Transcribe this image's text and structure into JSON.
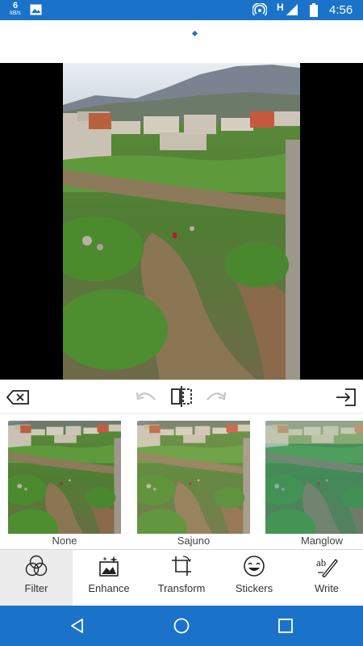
{
  "status_bar": {
    "speed_value": "6",
    "speed_unit": "kB/s",
    "network_type": "H",
    "time": "4:56",
    "icons": [
      "image-icon",
      "hotspot-icon",
      "signal-icon",
      "battery-icon"
    ]
  },
  "filters": [
    {
      "label": "None",
      "tint": "none"
    },
    {
      "label": "Sajuno",
      "tint": "warm"
    },
    {
      "label": "Manglow",
      "tint": "teal"
    }
  ],
  "tool_tabs": [
    {
      "label": "Filter",
      "icon": "filter-icon",
      "active": true
    },
    {
      "label": "Enhance",
      "icon": "enhance-icon",
      "active": false
    },
    {
      "label": "Transform",
      "icon": "transform-icon",
      "active": false
    },
    {
      "label": "Stickers",
      "icon": "stickers-icon",
      "active": false
    },
    {
      "label": "Write",
      "icon": "write-icon",
      "active": false
    }
  ],
  "edit_toolbar": {
    "icons": [
      "delete-icon",
      "undo-icon",
      "compare-icon",
      "redo-icon",
      "export-icon"
    ]
  },
  "nav_bar": {
    "icons": [
      "back-icon",
      "home-icon",
      "recents-icon"
    ]
  },
  "colors": {
    "accent": "#1a73c9",
    "active_tab_bg": "#ececec"
  }
}
